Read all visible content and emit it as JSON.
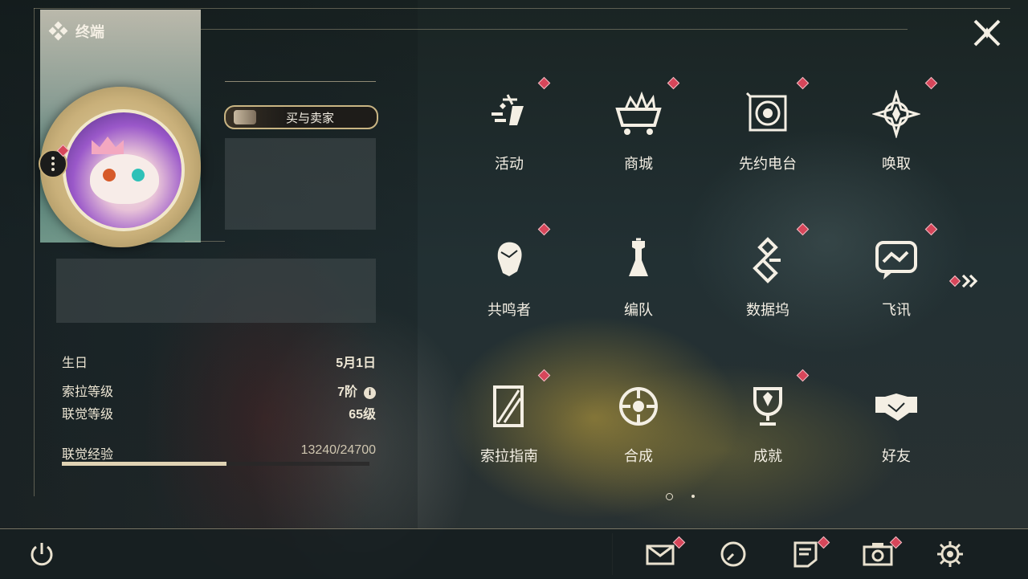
{
  "header": {
    "title": "终端",
    "close_icon": "close-x-icon"
  },
  "profile": {
    "title_badge": "买与卖家",
    "birthday_label": "生日",
    "birthday_value": "5月1日",
    "sola_level_label": "索拉等级",
    "sola_level_value": "7阶",
    "union_level_label": "联觉等级",
    "union_level_value": "65级",
    "union_xp_label": "联觉经验",
    "union_xp_value": "13240/24700",
    "xp_progress": 0.536
  },
  "menu": [
    {
      "label": "活动",
      "icon": "activity-icon",
      "badge": true
    },
    {
      "label": "商城",
      "icon": "shop-basket-icon",
      "badge": true
    },
    {
      "label": "先约电台",
      "icon": "radio-icon",
      "badge": true
    },
    {
      "label": "唤取",
      "icon": "convene-compass-icon",
      "badge": true
    },
    {
      "label": "共鸣者",
      "icon": "resonator-portrait-icon",
      "badge": true
    },
    {
      "label": "编队",
      "icon": "team-chess-icon",
      "badge": false
    },
    {
      "label": "数据坞",
      "icon": "data-bank-icon",
      "badge": true
    },
    {
      "label": "飞讯",
      "icon": "chat-bubble-icon",
      "badge": true
    },
    {
      "label": "索拉指南",
      "icon": "guidebook-icon",
      "badge": true
    },
    {
      "label": "合成",
      "icon": "synthesis-icon",
      "badge": false
    },
    {
      "label": "成就",
      "icon": "trophy-icon",
      "badge": true
    },
    {
      "label": "好友",
      "icon": "handshake-icon",
      "badge": false
    }
  ],
  "pagination": {
    "current": 1,
    "total": 2
  },
  "bottom_bar": [
    "power-icon",
    "mail-icon",
    "clock-icon",
    "notice-icon",
    "camera-icon",
    "settings-gear-icon"
  ],
  "colors": {
    "accent": "#c9b583",
    "badge_red": "#d7465a",
    "text": "#f4efe4"
  }
}
